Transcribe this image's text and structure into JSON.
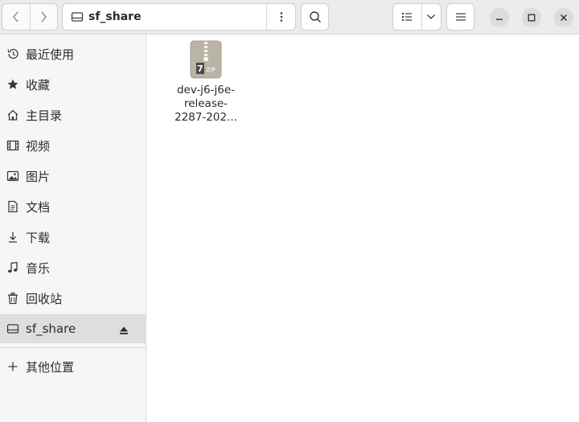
{
  "header": {
    "path": "sf_share"
  },
  "sidebar": {
    "items": [
      {
        "label": "最近使用",
        "icon": "recent-icon"
      },
      {
        "label": "收藏",
        "icon": "star-icon"
      },
      {
        "label": "主目录",
        "icon": "home-icon"
      },
      {
        "label": "视频",
        "icon": "video-icon"
      },
      {
        "label": "图片",
        "icon": "image-icon"
      },
      {
        "label": "文档",
        "icon": "document-icon"
      },
      {
        "label": "下载",
        "icon": "download-icon"
      },
      {
        "label": "音乐",
        "icon": "music-icon"
      },
      {
        "label": "回收站",
        "icon": "trash-icon"
      },
      {
        "label": "sf_share",
        "icon": "drive-icon",
        "active": true
      },
      {
        "label": "其他位置",
        "icon": "plus-icon"
      }
    ]
  },
  "files": [
    {
      "name_lines": [
        "dev-j6-j6e-",
        "release-",
        "2287-202..."
      ],
      "icon": "zip-archive-icon",
      "badge": "ZIP",
      "badge_num": "7"
    }
  ]
}
